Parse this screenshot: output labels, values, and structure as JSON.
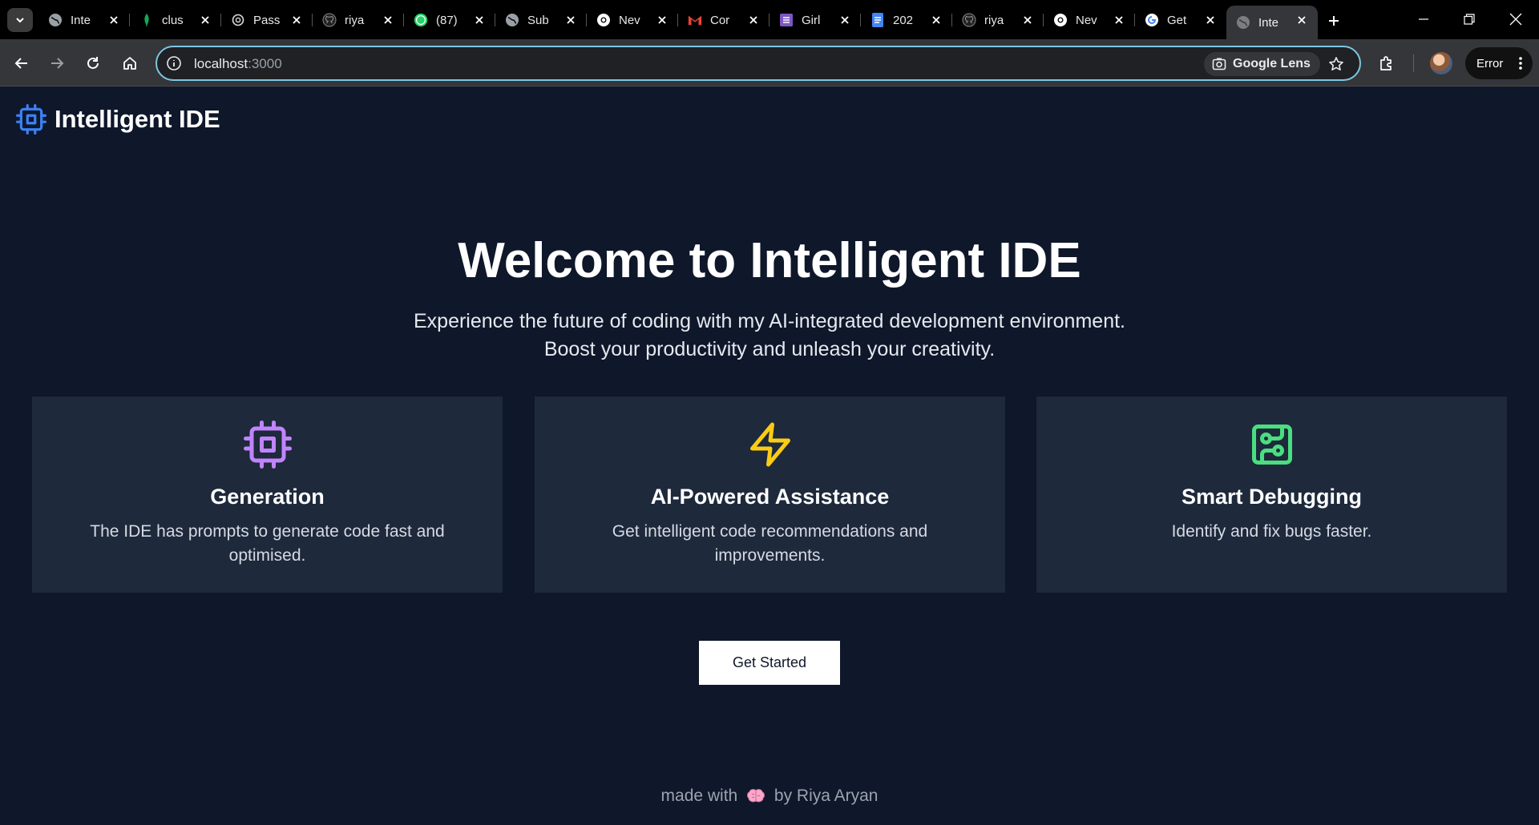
{
  "browser": {
    "tabs": [
      {
        "title": "Inte",
        "icon": "globe-icon"
      },
      {
        "title": "clus",
        "icon": "mongodb-leaf-icon"
      },
      {
        "title": "Pass",
        "icon": "openai-icon"
      },
      {
        "title": "riya",
        "icon": "github-icon"
      },
      {
        "title": "(87)",
        "icon": "whatsapp-icon"
      },
      {
        "title": "Sub",
        "icon": "globe-icon"
      },
      {
        "title": "Nev",
        "icon": "chrome-icon"
      },
      {
        "title": "Cor",
        "icon": "gmail-icon"
      },
      {
        "title": "Girl",
        "icon": "forms-icon"
      },
      {
        "title": "202",
        "icon": "docs-icon"
      },
      {
        "title": "riya",
        "icon": "github-icon"
      },
      {
        "title": "Nev",
        "icon": "chrome-icon"
      },
      {
        "title": "Get",
        "icon": "google-icon"
      },
      {
        "title": "Inte",
        "icon": "globe-icon",
        "active": true
      }
    ],
    "url_host": "localhost",
    "url_port": ":3000",
    "lens_label": "Google Lens",
    "error_label": "Error"
  },
  "app": {
    "title": "Intelligent IDE"
  },
  "hero": {
    "heading": "Welcome to Intelligent IDE",
    "subtitle": "Experience the future of coding with my AI-integrated development environment. Boost your productivity and unleash your creativity."
  },
  "features": [
    {
      "title": "Generation",
      "description": "The IDE has prompts to generate code fast and optimised.",
      "icon": "cpu-icon",
      "color": "#c084fc"
    },
    {
      "title": "AI-Powered Assistance",
      "description": "Get intelligent code recommendations and improvements.",
      "icon": "lightning-icon",
      "color": "#facc15"
    },
    {
      "title": "Smart Debugging",
      "description": "Identify and fix bugs faster.",
      "icon": "circuit-board-icon",
      "color": "#4ade80"
    }
  ],
  "cta": {
    "label": "Get Started"
  },
  "footer": {
    "made_with": "made with",
    "by": "by Riya Aryan"
  },
  "colors": {
    "background": "#0f172a",
    "card": "#1e293b",
    "accent": "#3b82f6"
  }
}
